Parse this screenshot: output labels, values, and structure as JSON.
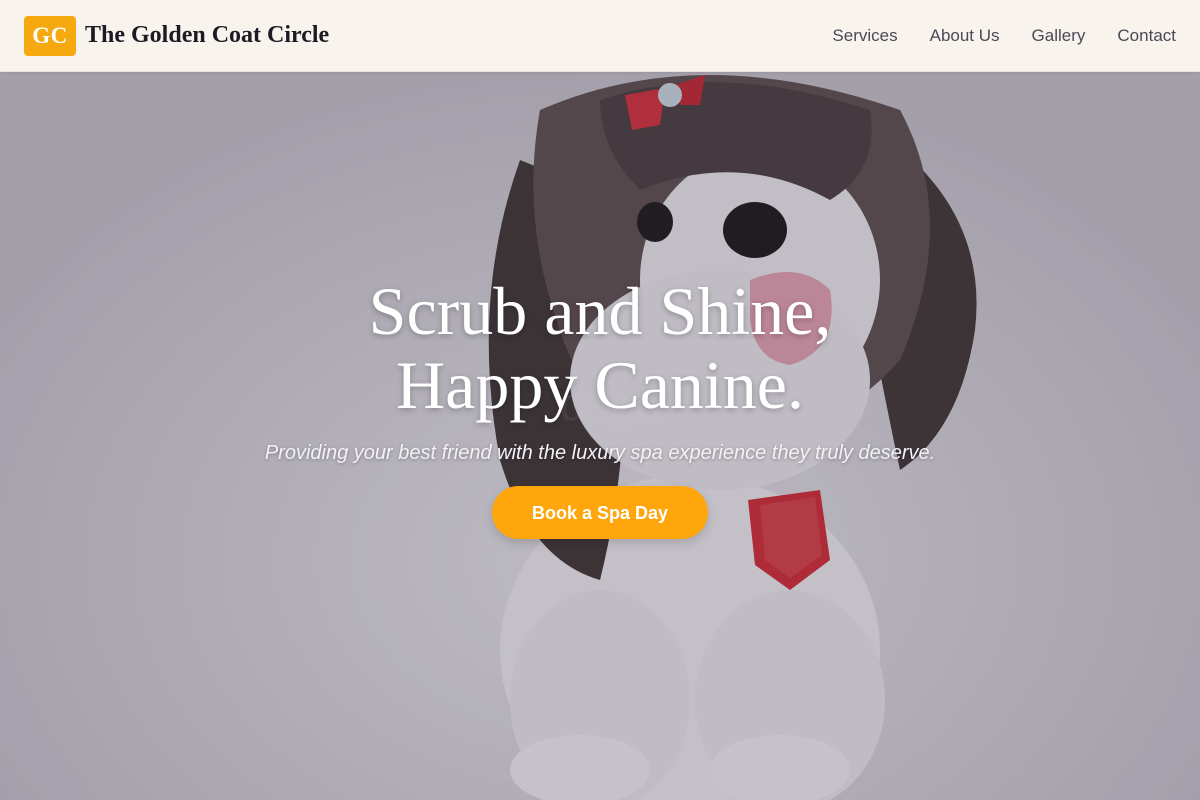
{
  "header": {
    "logo_initials": "GC",
    "brand_name": "The Golden Coat Circle",
    "nav": [
      {
        "label": "Services"
      },
      {
        "label": "About Us"
      },
      {
        "label": "Gallery"
      },
      {
        "label": "Contact"
      }
    ]
  },
  "hero": {
    "title_line1": "Scrub and Shine,",
    "title_line2": "Happy Canine.",
    "subtitle": "Providing your best friend with the luxury spa experience they truly deserve.",
    "cta_label": "Book a Spa Day"
  },
  "colors": {
    "accent": "#fea60b",
    "logo_badge": "#f5a90e",
    "header_bg": "#fffaf2",
    "nav_text": "#4a4a57",
    "brand_text": "#1c1a24"
  }
}
